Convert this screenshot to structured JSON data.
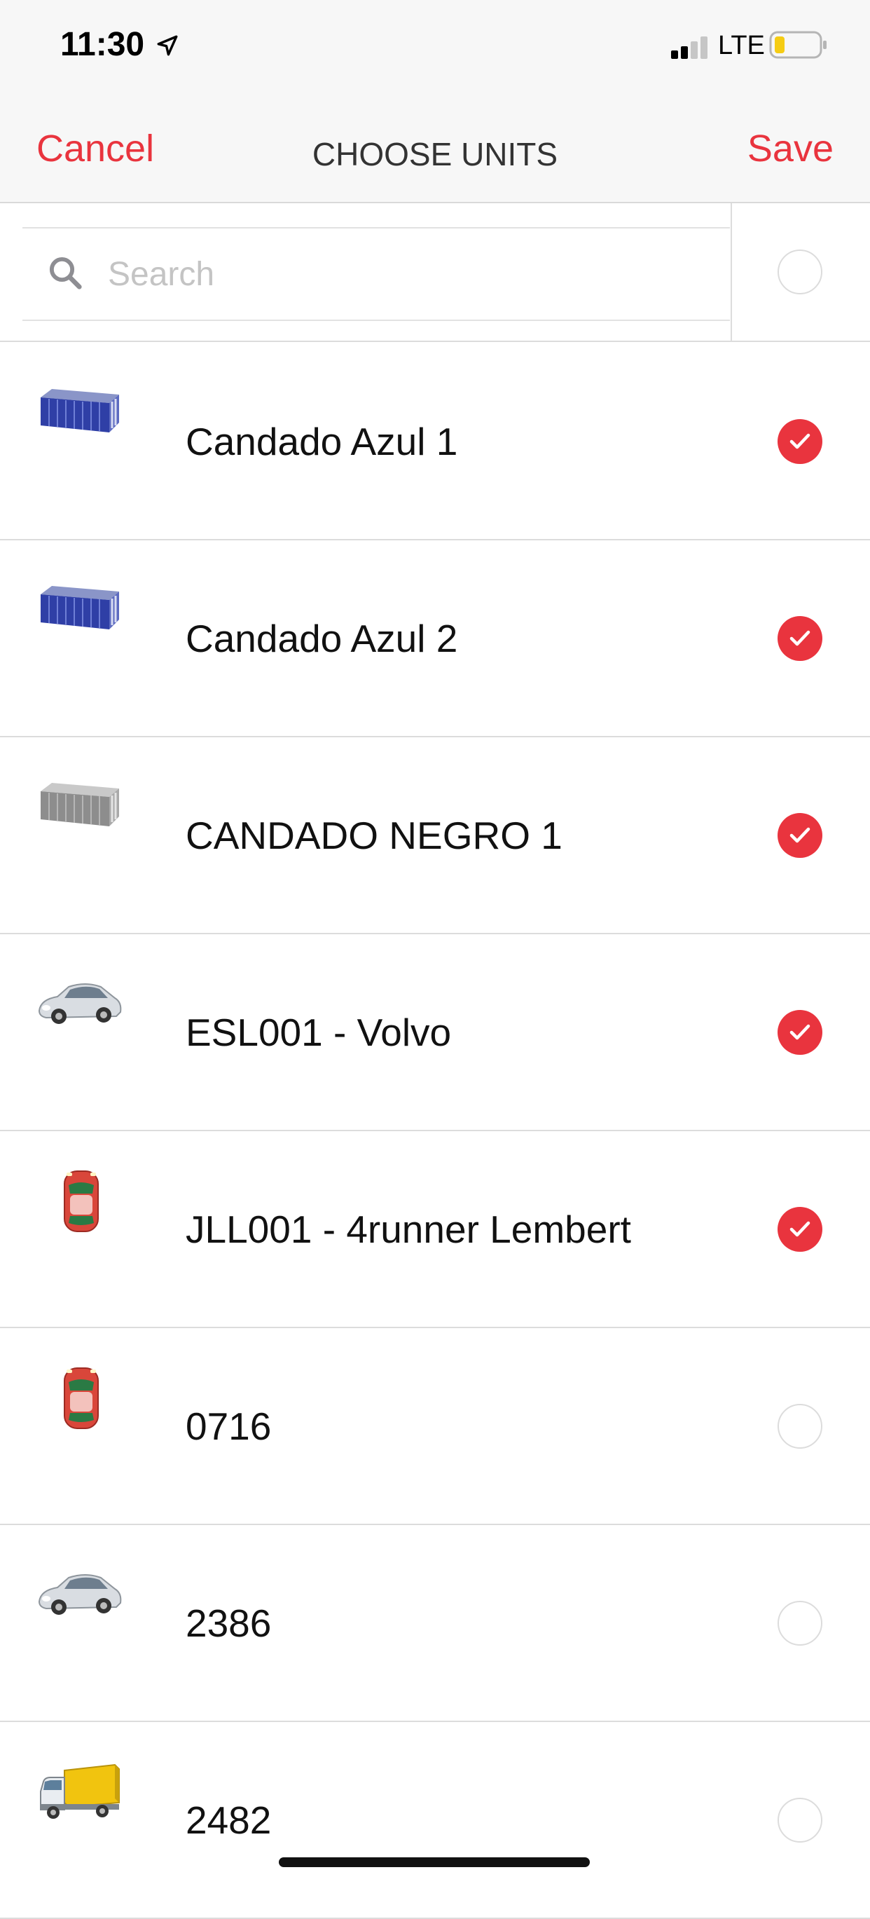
{
  "status_bar": {
    "time": "11:30",
    "network": "LTE",
    "icons": [
      "location-arrow-icon",
      "signal-bars-icon",
      "battery-low-icon"
    ]
  },
  "nav": {
    "cancel_label": "Cancel",
    "title": "CHOOSE UNITS",
    "save_label": "Save"
  },
  "search": {
    "placeholder": "Search",
    "value": "",
    "select_all_checked": false
  },
  "colors": {
    "accent": "#e9343e",
    "nav_background": "#f7f7f7",
    "separator": "#dcdcdc"
  },
  "units": [
    {
      "name": "Candado Azul 1",
      "icon": "blue-container-icon",
      "checked": true
    },
    {
      "name": "Candado Azul 2",
      "icon": "blue-container-icon",
      "checked": true
    },
    {
      "name": "CANDADO NEGRO 1",
      "icon": "gray-container-icon",
      "checked": true
    },
    {
      "name": "ESL001 - Volvo",
      "icon": "silver-car-icon",
      "checked": true
    },
    {
      "name": "JLL001 - 4runner Lembert",
      "icon": "red-car-top-icon",
      "checked": true
    },
    {
      "name": "0716",
      "icon": "red-car-top-icon",
      "checked": false
    },
    {
      "name": "2386",
      "icon": "silver-car-icon",
      "checked": false
    },
    {
      "name": "2482",
      "icon": "yellow-truck-icon",
      "checked": false
    }
  ]
}
